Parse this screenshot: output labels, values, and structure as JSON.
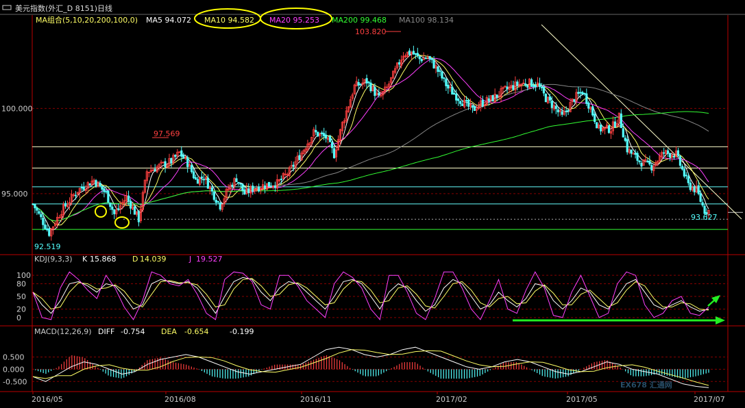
{
  "window": {
    "title": "美元指数(外汇_D 8151)日线",
    "icon": "window-restore-icon"
  },
  "colors": {
    "background": "#000000",
    "up": "#ff4040",
    "down": "#54ffff",
    "ma5": "#ffffff",
    "ma10": "#ffff66",
    "ma20": "#ff40ff",
    "ma200": "#33ff33",
    "ma100": "#888888",
    "grid": "#880000",
    "axis_text": "#cccccc",
    "annotation_circle": "#ffff00",
    "annotation_arrow": "#22ee22"
  },
  "legend_main": [
    {
      "key": "group",
      "text": "MA组合(5,10,20,200,100,0)",
      "color": "#ffff66"
    },
    {
      "key": "ma5",
      "text": "MA5 94.072",
      "color": "#ffffff"
    },
    {
      "key": "ma10",
      "text": "MA10 94.582",
      "color": "#ffff66"
    },
    {
      "key": "ma20",
      "text": "MA20 95.253",
      "color": "#ff40ff"
    },
    {
      "key": "ma200",
      "text": "MA200 99.468",
      "color": "#33ff33"
    },
    {
      "key": "ma100",
      "text": "MA100 98.134",
      "color": "#888888"
    }
  ],
  "legend_kdj": [
    {
      "text": "KDJ(9,3,3)",
      "color": "#cccccc"
    },
    {
      "text": "K",
      "color": "#ffffff"
    },
    {
      "text": "15.868",
      "color": "#ffffff"
    },
    {
      "text": "D",
      "color": "#ffff66"
    },
    {
      "text": "14.039",
      "color": "#ffff66"
    },
    {
      "text": "J",
      "color": "#ff40ff"
    },
    {
      "text": "19.527",
      "color": "#ff40ff"
    }
  ],
  "legend_macd": [
    {
      "text": "MACD(12,26,9)",
      "color": "#cccccc"
    },
    {
      "text": "DIFF",
      "color": "#ffffff"
    },
    {
      "text": "-0.754",
      "color": "#ffffff"
    },
    {
      "text": "DEA",
      "color": "#ffff66"
    },
    {
      "text": "-0.654",
      "color": "#ffff66"
    },
    {
      "text": "-0.199",
      "color": "#ffffff"
    }
  ],
  "price_annotations": {
    "high": "103.820",
    "high_mid": "97.569",
    "last": "93.627",
    "low": "92.519"
  },
  "watermark": "EX678 汇通网",
  "chart_data": {
    "type": "candlestick",
    "x_tick_labels": [
      "2016/05",
      "2016/08",
      "2016/11",
      "2017/02",
      "2017/05",
      "2017/07"
    ],
    "price_axis": {
      "ticks": [
        "100.000",
        "95.000"
      ],
      "ylim": [
        91.5,
        105.4
      ]
    },
    "key_points": {
      "high": 103.82,
      "high_mid": 97.569,
      "low": 92.519,
      "last_close": 93.627
    },
    "moving_averages": {
      "MA5": 94.072,
      "MA10": 94.582,
      "MA20": 95.253,
      "MA200": 99.468,
      "MA100": 98.134
    },
    "horizontal_levels": [
      {
        "value": 97.75,
        "color": "#ffffcc"
      },
      {
        "value": 96.5,
        "color": "#ffffcc"
      },
      {
        "value": 95.4,
        "color": "#66ffff"
      },
      {
        "value": 94.4,
        "color": "#66ffff"
      },
      {
        "value": 92.9,
        "color": "#33ff33"
      }
    ],
    "close_path": [
      [
        0,
        94.4
      ],
      [
        8,
        92.7
      ],
      [
        14,
        94.0
      ],
      [
        22,
        95.2
      ],
      [
        30,
        95.8
      ],
      [
        36,
        95.0
      ],
      [
        40,
        93.8
      ],
      [
        46,
        94.8
      ],
      [
        52,
        93.5
      ],
      [
        56,
        96.3
      ],
      [
        62,
        96.6
      ],
      [
        68,
        96.9
      ],
      [
        72,
        97.4
      ],
      [
        76,
        96.8
      ],
      [
        80,
        95.8
      ],
      [
        84,
        96.0
      ],
      [
        88,
        95.1
      ],
      [
        92,
        94.3
      ],
      [
        96,
        95.3
      ],
      [
        100,
        95.9
      ],
      [
        104,
        95.0
      ],
      [
        108,
        95.3
      ],
      [
        114,
        95.5
      ],
      [
        120,
        95.6
      ],
      [
        126,
        96.3
      ],
      [
        132,
        97.4
      ],
      [
        138,
        98.6
      ],
      [
        144,
        98.3
      ],
      [
        148,
        97.3
      ],
      [
        152,
        99.1
      ],
      [
        158,
        101.3
      ],
      [
        164,
        101.6
      ],
      [
        170,
        100.6
      ],
      [
        174,
        101.2
      ],
      [
        178,
        102.2
      ],
      [
        182,
        103.2
      ],
      [
        186,
        103.3
      ],
      [
        190,
        102.9
      ],
      [
        194,
        103.0
      ],
      [
        198,
        102.4
      ],
      [
        204,
        101.2
      ],
      [
        210,
        100.5
      ],
      [
        216,
        99.9
      ],
      [
        220,
        100.3
      ],
      [
        226,
        100.6
      ],
      [
        232,
        101.1
      ],
      [
        238,
        101.4
      ],
      [
        244,
        101.5
      ],
      [
        248,
        101.4
      ],
      [
        252,
        100.6
      ],
      [
        256,
        100.1
      ],
      [
        260,
        99.5
      ],
      [
        266,
        100.6
      ],
      [
        270,
        101.0
      ],
      [
        274,
        100.0
      ],
      [
        278,
        98.8
      ],
      [
        284,
        98.8
      ],
      [
        288,
        99.5
      ],
      [
        292,
        97.6
      ],
      [
        298,
        96.9
      ],
      [
        304,
        96.6
      ],
      [
        310,
        97.4
      ],
      [
        316,
        97.3
      ],
      [
        322,
        95.5
      ],
      [
        326,
        95.2
      ],
      [
        330,
        94.0
      ]
    ],
    "kdj_axis": {
      "ticks": [
        "100",
        "80",
        "50",
        "20",
        "0"
      ],
      "ylim": [
        -10,
        110
      ],
      "last": {
        "K": 15.868,
        "D": 14.039,
        "J": 19.527
      }
    },
    "kdj_k": [
      60,
      30,
      10,
      40,
      80,
      85,
      75,
      60,
      80,
      75,
      50,
      20,
      30,
      80,
      90,
      85,
      80,
      85,
      70,
      40,
      10,
      50,
      85,
      95,
      90,
      60,
      40,
      70,
      85,
      80,
      60,
      40,
      20,
      50,
      85,
      90,
      80,
      50,
      20,
      60,
      80,
      70,
      40,
      15,
      30,
      70,
      90,
      80,
      50,
      20,
      30,
      60,
      40,
      25,
      45,
      80,
      75,
      40,
      20,
      40,
      70,
      60,
      30,
      20,
      50,
      80,
      90,
      60,
      30,
      20,
      30,
      40,
      25,
      15,
      20
    ],
    "macd_axis": {
      "ticks": [
        "0.500",
        "0.000",
        "-0.500"
      ],
      "ylim": [
        -0.8,
        1.1
      ],
      "last": {
        "DIFF": -0.754,
        "DEA": -0.654,
        "MACD": -0.199
      }
    },
    "macd_diff": [
      -0.3,
      -0.5,
      -0.2,
      0.1,
      0.3,
      0.2,
      0.0,
      -0.2,
      -0.1,
      0.2,
      0.4,
      0.5,
      0.6,
      0.5,
      0.3,
      0.1,
      -0.1,
      -0.2,
      -0.1,
      0.0,
      0.1,
      0.2,
      0.5,
      0.8,
      0.9,
      0.8,
      0.6,
      0.5,
      0.6,
      0.8,
      0.9,
      0.7,
      0.5,
      0.3,
      0.1,
      0.0,
      0.1,
      0.3,
      0.4,
      0.3,
      0.1,
      -0.1,
      -0.2,
      -0.1,
      0.1,
      0.3,
      0.2,
      0.0,
      -0.1,
      -0.2,
      -0.4,
      -0.6,
      -0.7,
      -0.75
    ],
    "annotations": [
      {
        "type": "ellipse",
        "label": "MA10 legend highlight"
      },
      {
        "type": "ellipse",
        "label": "MA20 legend highlight"
      },
      {
        "type": "circle",
        "label": "swing low 1"
      },
      {
        "type": "circle",
        "label": "swing low 2"
      },
      {
        "type": "arrow",
        "label": "KDJ flat bottom"
      },
      {
        "type": "arrow",
        "label": "KDJ turning up"
      }
    ]
  }
}
